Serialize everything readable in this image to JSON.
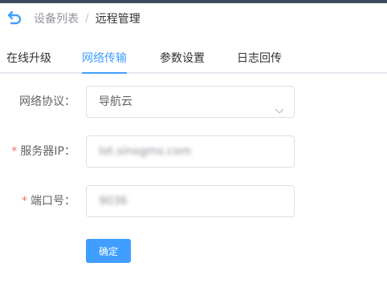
{
  "header": {
    "back_icon": "back-arrow-icon",
    "breadcrumb_parent": "设备列表",
    "breadcrumb_separator": "/",
    "breadcrumb_current": "远程管理"
  },
  "tabs": [
    {
      "label": "在线升级",
      "active": false
    },
    {
      "label": "网络传输",
      "active": true
    },
    {
      "label": "参数设置",
      "active": false
    },
    {
      "label": "日志回传",
      "active": false
    }
  ],
  "form": {
    "protocol_label": "网络协议：",
    "protocol_value": "导航云",
    "server_ip_label": "服务器IP：",
    "server_ip_value": "lot.sinogms.com",
    "port_label": "端口号：",
    "port_value": "9036",
    "required_mark": "*"
  },
  "actions": {
    "confirm_label": "确定"
  },
  "colors": {
    "accent": "#409eff",
    "required": "#f56c6c",
    "top_strip": "#3e4a5c"
  }
}
